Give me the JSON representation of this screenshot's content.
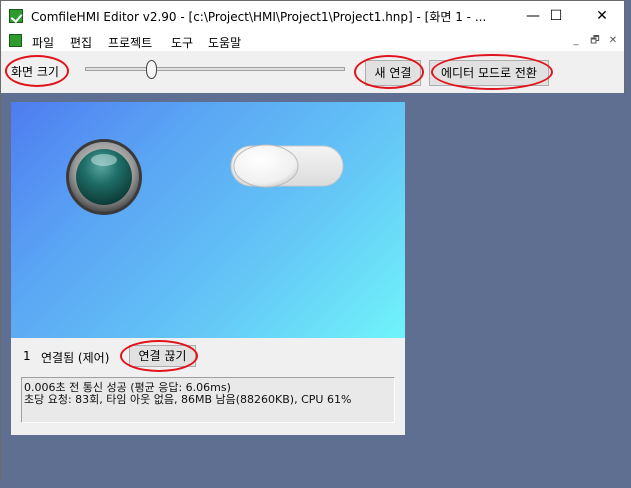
{
  "window": {
    "title": "ComfileHMI Editor v2.90 - [c:\\Project\\HMI\\Project1\\Project1.hnp] - [화면 1 - ...",
    "minimize_glyph": "—",
    "maximize_glyph": "☐",
    "close_glyph": "✕"
  },
  "menu": {
    "items": [
      "파일",
      "편집",
      "프로젝트",
      "도구",
      "도움말"
    ],
    "mdi_minimize": "_",
    "mdi_restore": "🗗",
    "mdi_close": "✕"
  },
  "toolbar": {
    "zoom_label": "화면 크기",
    "zoom_level": 0.25,
    "new_connection": "새 연결",
    "editor_mode": "에디터 모드로 전환"
  },
  "status": {
    "index": "1",
    "connection_status": "연결됨 (제어)",
    "disconnect": "연결 끊기"
  },
  "log": {
    "line1": "0.006초 전 통신 성공 (평균 응답: 6.06ms)",
    "line2": "초당 요청: 83회, 타임 아웃 없음, 86MB 남음(88260KB), CPU 61%"
  },
  "colors": {
    "annotation_ring": "#e0141c",
    "canvas_gradient_start": "#4e7cf0",
    "canvas_gradient_end": "#70f4fa",
    "lamp_color": "#1f6e67"
  },
  "icons": [
    "app-icon",
    "minimize-icon",
    "maximize-icon",
    "close-icon",
    "lamp-widget",
    "toggle-switch"
  ]
}
